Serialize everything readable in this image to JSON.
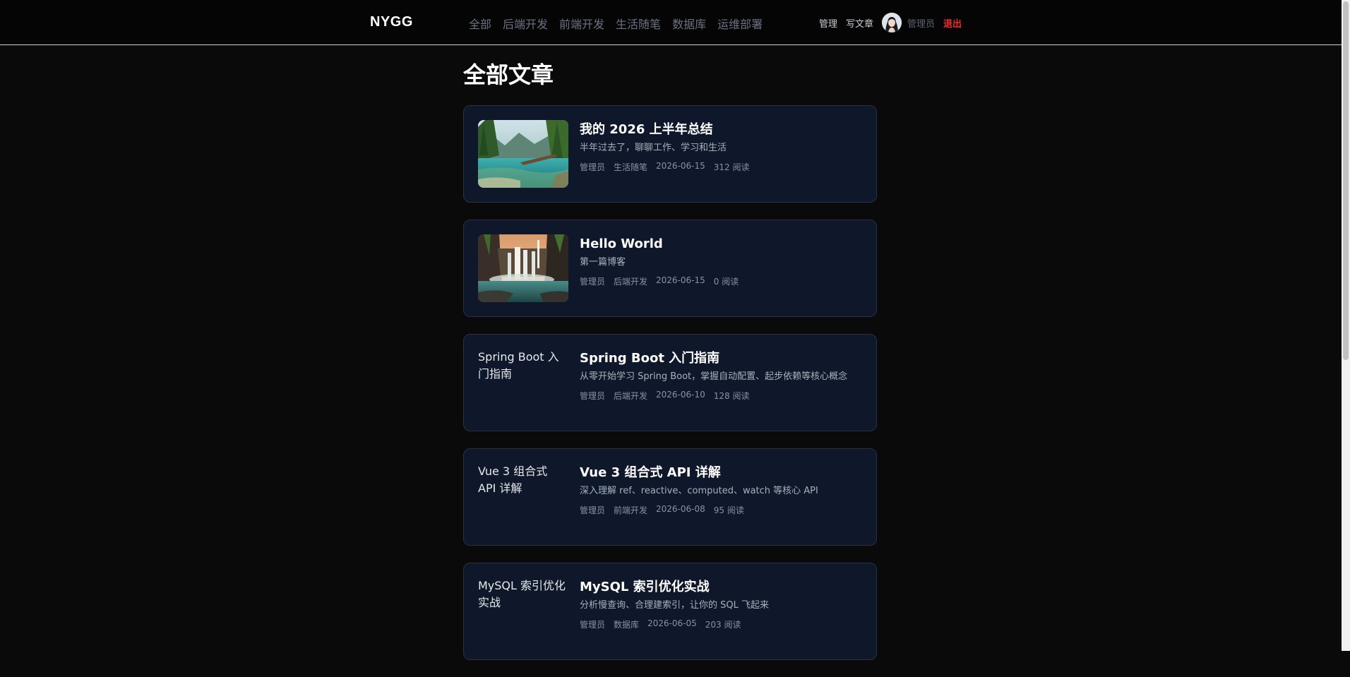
{
  "header": {
    "brand": "NYGG",
    "nav": [
      "全部",
      "后端开发",
      "前端开发",
      "生活随笔",
      "数据库",
      "运维部署"
    ],
    "manage_label": "管理",
    "write_label": "写文章",
    "username": "管理员",
    "logout_label": "退出"
  },
  "page": {
    "title": "全部文章"
  },
  "posts": [
    {
      "title": "我的 2026 上半年总结",
      "summary": "半年过去了，聊聊工作、学习和生活",
      "author": "管理员",
      "category": "生活随笔",
      "date": "2026-06-15",
      "views": "312 阅读",
      "cover": "forest-lake-image"
    },
    {
      "title": "Hello World",
      "summary": "第一篇博客",
      "author": "管理员",
      "category": "后端开发",
      "date": "2026-06-15",
      "views": "0 阅读",
      "cover": "waterfall-image"
    },
    {
      "title": "Spring Boot 入门指南",
      "summary": "从零开始学习 Spring Boot，掌握自动配置、起步依赖等核心概念",
      "author": "管理员",
      "category": "后端开发",
      "date": "2026-06-10",
      "views": "128 阅读",
      "cover_alt": "Spring Boot 入门指南"
    },
    {
      "title": "Vue 3 组合式 API 详解",
      "summary": "深入理解 ref、reactive、computed、watch 等核心 API",
      "author": "管理员",
      "category": "前端开发",
      "date": "2026-06-08",
      "views": "95 阅读",
      "cover_alt": "Vue 3 组合式 API 详解"
    },
    {
      "title": "MySQL 索引优化实战",
      "summary": "分析慢查询、合理建索引，让你的 SQL 飞起来",
      "author": "管理员",
      "category": "数据库",
      "date": "2026-06-05",
      "views": "203 阅读",
      "cover_alt": "MySQL 索引优化实战"
    }
  ],
  "colors": {
    "background": "#0a0a0a",
    "card": "#0f172a",
    "logout": "#ef2b2b",
    "nav": "#6b7280"
  }
}
